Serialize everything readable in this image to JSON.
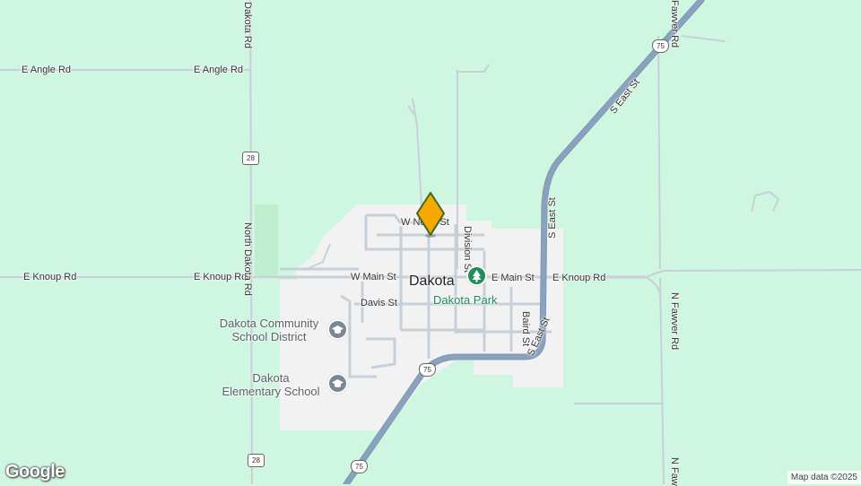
{
  "map": {
    "town": "Dakota",
    "park": "Dakota Park",
    "schools": [
      "Dakota Community School District",
      "Dakota Elementary School"
    ],
    "school_lines": [
      [
        "Dakota Community",
        "School District"
      ],
      [
        "Dakota",
        "Elementary School"
      ]
    ],
    "roads": {
      "e_angle_left": "E Angle Rd",
      "e_angle_right": "E Angle Rd",
      "e_knoup_left": "E Knoup Rd",
      "e_knoup_mid": "E Knoup Rd",
      "e_knoup_right": "E Knoup Rd",
      "north_dakota_top": "Dakota Rd",
      "north_dakota_mid": "North Dakota Rd",
      "w_main": "W Main St",
      "e_main": "E Main St",
      "w_north": "W North St",
      "davis": "Davis St",
      "division": "Division St",
      "baird": "Baird St",
      "s_east_upper": "S East St",
      "s_east_mid": "S East St",
      "s_east_lower": "S East St",
      "n_fawver_top": "Fawver Rd",
      "n_fawver_mid": "N Fawver Rd",
      "n_fawver_bottom": "N Faw"
    },
    "shields": {
      "r28_top": "28",
      "r28_bottom": "28",
      "r75_top": "75",
      "r75_mid": "75",
      "r75_bottom": "75"
    },
    "attribution": "Map data ©2025",
    "logo": "Google",
    "colors": {
      "land": "#cff6e1",
      "urban": "#f2f2f2",
      "highway": "#8ba2bf",
      "minor_road": "#c7d0d9",
      "marker": "#f7a800",
      "park_green": "#1e8e5a"
    }
  }
}
